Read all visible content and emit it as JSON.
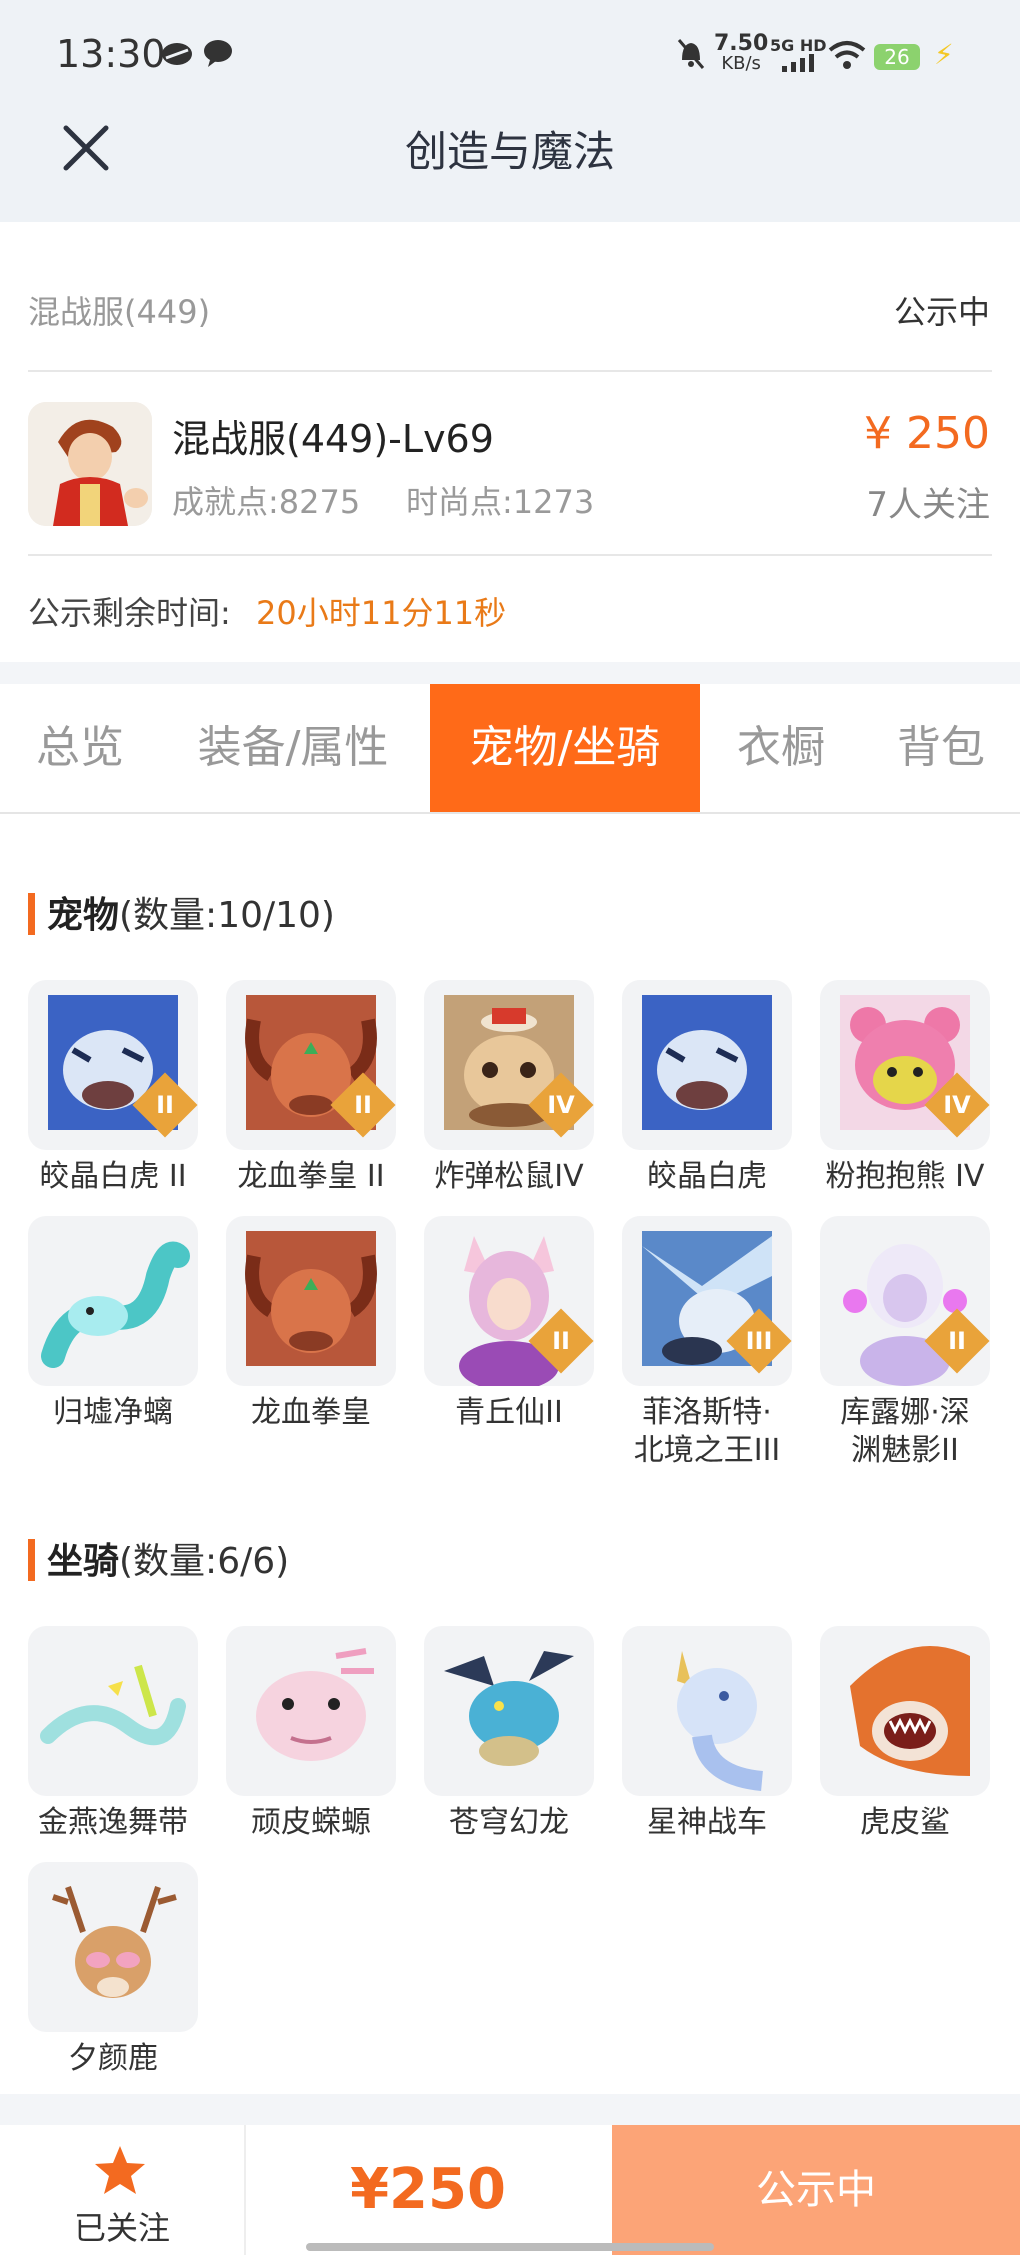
{
  "status_bar": {
    "time": "13:30",
    "net_speed_value": "7.50",
    "net_speed_unit": "KB/s",
    "network": "5G HD",
    "battery": "26"
  },
  "header": {
    "title": "创造与魔法"
  },
  "info": {
    "server_name": "混战服(449)",
    "status": "公示中",
    "character_name": "混战服(449)-Lv69",
    "achievement": "成就点:8275",
    "fashion": "时尚点:1273",
    "price": "¥ 250",
    "followers": "7人关注",
    "remaining_label": "公示剩余时间:",
    "remaining_time": "20小时11分11秒"
  },
  "tabs": [
    {
      "label": "总览",
      "active": false
    },
    {
      "label": "装备/属性",
      "active": false
    },
    {
      "label": "宠物/坐骑",
      "active": true
    },
    {
      "label": "衣橱",
      "active": false
    },
    {
      "label": "背包",
      "active": false
    }
  ],
  "pets": {
    "title": "宠物",
    "count": "(数量:10/10)",
    "items": [
      {
        "name": "皎晶白虎 II",
        "rank": "II",
        "icon": "white-tiger-icon"
      },
      {
        "name": "龙血拳皇 II",
        "rank": "II",
        "icon": "dragon-blood-boxer-icon"
      },
      {
        "name": "炸弹松鼠IV",
        "rank": "IV",
        "icon": "bomb-squirrel-icon"
      },
      {
        "name": "皎晶白虎",
        "rank": "",
        "icon": "white-tiger-icon"
      },
      {
        "name": "粉抱抱熊 IV",
        "rank": "IV",
        "icon": "pink-bear-icon"
      },
      {
        "name": "归墟净螭",
        "rank": "",
        "icon": "water-dragon-icon"
      },
      {
        "name": "龙血拳皇",
        "rank": "",
        "icon": "dragon-blood-boxer-icon"
      },
      {
        "name": "青丘仙II",
        "rank": "II",
        "icon": "fox-fairy-icon"
      },
      {
        "name": "菲洛斯特·\n北境之王III",
        "rank": "III",
        "icon": "north-king-icon"
      },
      {
        "name": "库露娜·深\n渊魅影II",
        "rank": "II",
        "icon": "abyss-phantom-icon"
      }
    ]
  },
  "mounts": {
    "title": "坐骑",
    "count": "(数量:6/6)",
    "items": [
      {
        "name": "金燕逸舞带",
        "icon": "golden-swallow-icon"
      },
      {
        "name": "顽皮蝾螈",
        "icon": "axolotl-icon"
      },
      {
        "name": "苍穹幻龙",
        "icon": "sky-dragon-icon"
      },
      {
        "name": "星神战车",
        "icon": "star-chariot-icon"
      },
      {
        "name": "虎皮鲨",
        "icon": "tiger-shark-icon"
      },
      {
        "name": "夕颜鹿",
        "icon": "deer-icon"
      }
    ]
  },
  "bottom_bar": {
    "follow_label": "已关注",
    "price": "¥250",
    "action_label": "公示中"
  },
  "colors": {
    "accent": "#f36a20",
    "tab_active": "#ff6a18",
    "action_button": "#fca477"
  }
}
